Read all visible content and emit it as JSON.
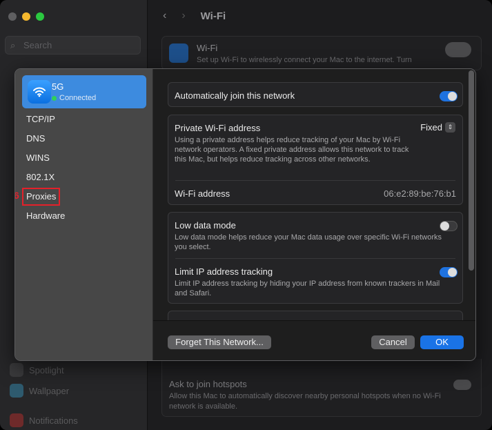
{
  "window": {
    "title": "Wi-Fi",
    "colors": {
      "red": "#5f5f61",
      "yellow": "#f5b82e",
      "green": "#2bc840"
    }
  },
  "sidebar": {
    "search_placeholder": "Search",
    "items": [
      {
        "label": "Spotlight"
      },
      {
        "label": "Wallpaper"
      },
      {
        "label": "Notifications"
      }
    ]
  },
  "background": {
    "wifi_title": "Wi-Fi",
    "wifi_desc": "Set up Wi-Fi to wirelessly connect your Mac to the internet. Turn",
    "hotspots_title": "Ask to join hotspots",
    "hotspots_desc": "Allow this Mac to automatically discover nearby personal hotspots when no Wi-Fi network is available."
  },
  "dialog": {
    "network": {
      "name": "5G",
      "status": "Connected"
    },
    "nav": [
      "TCP/IP",
      "DNS",
      "WINS",
      "802.1X",
      "Proxies",
      "Hardware"
    ],
    "annotation": "6",
    "auto_join": {
      "label": "Automatically join this network",
      "on": true
    },
    "private": {
      "label": "Private Wi-Fi address",
      "value": "Fixed",
      "desc": "Using a private address helps reduce tracking of your Mac by Wi-Fi network operators. A fixed private address allows this network to track this Mac, but helps reduce tracking across other networks."
    },
    "address": {
      "label": "Wi-Fi address",
      "value": "06:e2:89:be:76:b1"
    },
    "low_data": {
      "label": "Low data mode",
      "desc": "Low data mode helps reduce your Mac data usage over specific Wi-Fi networks you select.",
      "on": false
    },
    "limit_ip": {
      "label": "Limit IP address tracking",
      "desc": "Limit IP address tracking by hiding your IP address from known trackers in Mail and Safari.",
      "on": true
    },
    "buttons": {
      "forget": "Forget This Network...",
      "cancel": "Cancel",
      "ok": "OK"
    }
  }
}
